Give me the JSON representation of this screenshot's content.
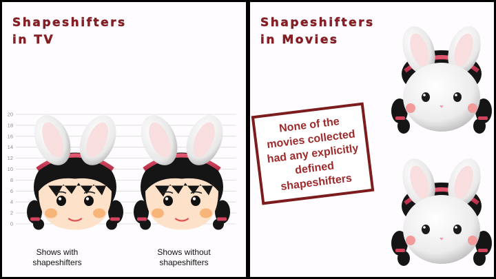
{
  "left_panel": {
    "title_lines": [
      "Shapeshifters",
      "in TV"
    ]
  },
  "right_panel": {
    "title_lines": [
      "Shapeshifters",
      "in Movies"
    ],
    "notice": "None of the movies collected had any explicitly defined shapeshifters"
  },
  "chart_data": {
    "type": "bar",
    "categories": [
      "Shows with\nshapeshifters",
      "Shows without\nshapeshifters"
    ],
    "category_lines": [
      [
        "Shows with",
        "shapeshifters"
      ],
      [
        "Shows without",
        "shapeshifters"
      ]
    ],
    "values": [
      11,
      11
    ],
    "ylim": [
      0,
      20
    ],
    "yticks": [
      0,
      2,
      4,
      6,
      8,
      10,
      12,
      14,
      16,
      18,
      20
    ],
    "grid": true,
    "mark": "pictogram",
    "title": "",
    "xlabel": "",
    "ylabel": ""
  },
  "colors": {
    "title": "#8c1e24",
    "notice_border": "#7c1c1f",
    "notice_text": "#9e2a2b",
    "panel_bg": "#fefcfe",
    "hair": "#151515",
    "skin": "#fde1c9",
    "cheek": "#f7b57a"
  },
  "icons": {
    "tv_figure": "bunny-girl-icon",
    "movie_figure": "faceless-bunny-girl-icon"
  }
}
